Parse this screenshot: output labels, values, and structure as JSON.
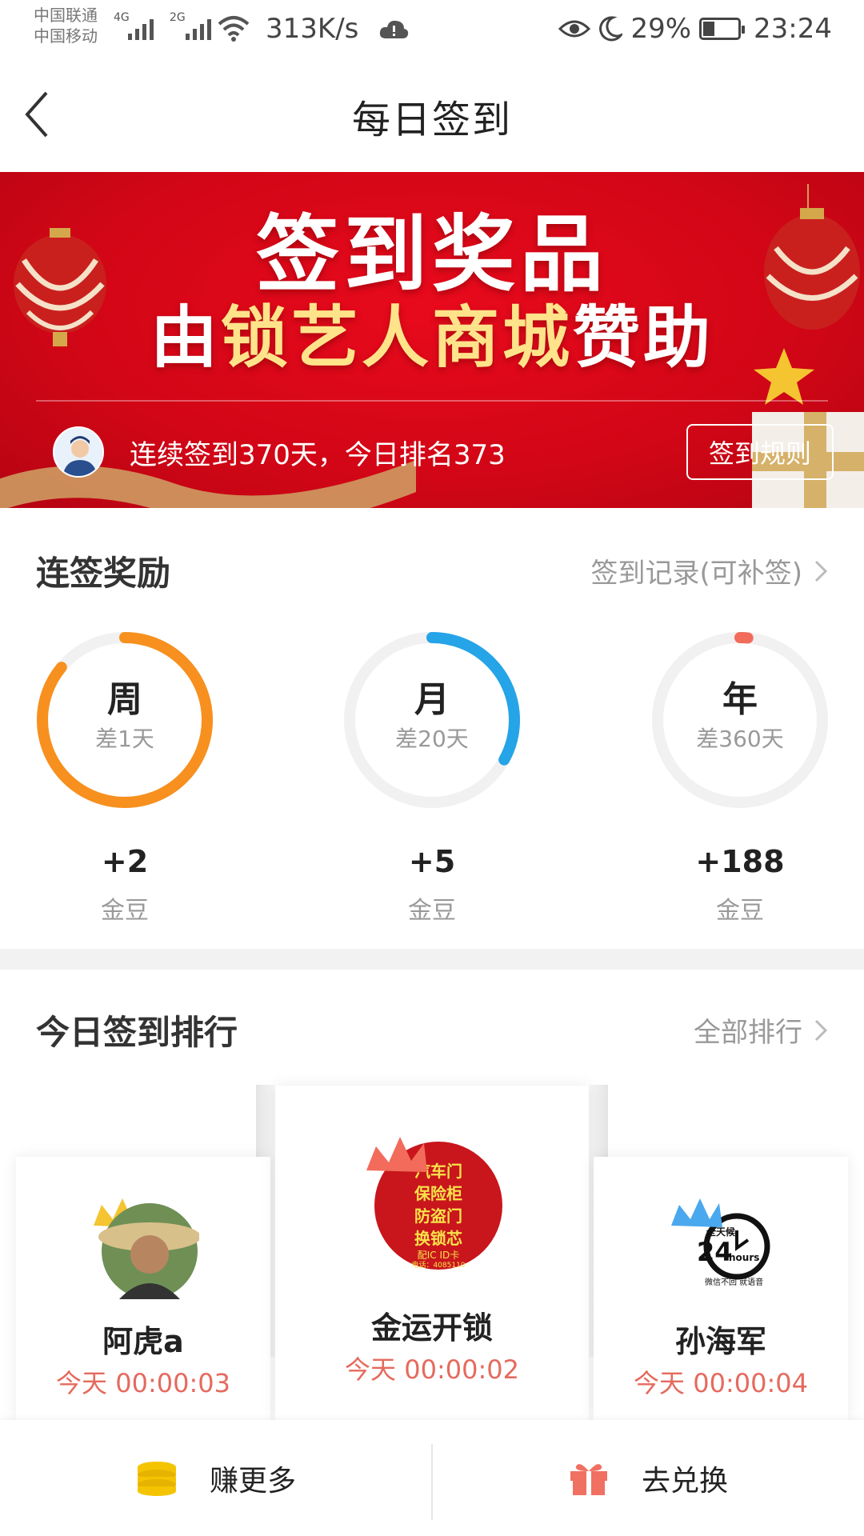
{
  "status_bar": {
    "carrier1": "中国联通",
    "carrier2": "中国移动",
    "net1": "4G",
    "net2": "2G",
    "speed": "313K/s",
    "battery": "29%",
    "time": "23:24"
  },
  "header": {
    "title": "每日签到"
  },
  "banner": {
    "title_line1": "签到奖品",
    "title_line2_a": "由",
    "title_line2_b": "锁艺人商城",
    "title_line2_c": "赞助",
    "streak_info": "连续签到370天，今日排名373",
    "rules_button": "签到规则"
  },
  "streak": {
    "title": "连签奖励",
    "link": "签到记录(可补签)",
    "items": [
      {
        "label": "周",
        "sub": "差1天",
        "reward": "+2",
        "unit": "金豆",
        "progress": 0.86,
        "color": "#f7901e"
      },
      {
        "label": "月",
        "sub": "差20天",
        "reward": "+5",
        "unit": "金豆",
        "progress": 0.33,
        "color": "#25a4e8"
      },
      {
        "label": "年",
        "sub": "差360天",
        "reward": "+188",
        "unit": "金豆",
        "progress": 0.015,
        "color": "#f26b5b"
      }
    ]
  },
  "ranking": {
    "title": "今日签到排行",
    "link": "全部排行",
    "users": [
      {
        "rank": 2,
        "name": "阿虎a",
        "time": "今天 00:00:03"
      },
      {
        "rank": 1,
        "name": "金运开锁",
        "time": "今天 00:00:02",
        "avatar_text": [
          "汽车门",
          "保险柜",
          "防盗门",
          "换锁芯",
          "配IC ID卡",
          "电话：4085110"
        ]
      },
      {
        "rank": 3,
        "name": "孙海军",
        "time": "今天 00:00:04",
        "avatar_text": [
          "全天候",
          "24",
          "hours",
          "微信不回 就语音"
        ]
      }
    ]
  },
  "bottom": {
    "earn_more": "赚更多",
    "exchange": "去兑换"
  },
  "colors": {
    "banner_red": "#d10616",
    "accent_red": "#e56a5e",
    "week": "#f7901e",
    "month": "#25a4e8",
    "year": "#f26b5b",
    "coin": "#f5c400",
    "gift": "#f07062"
  }
}
